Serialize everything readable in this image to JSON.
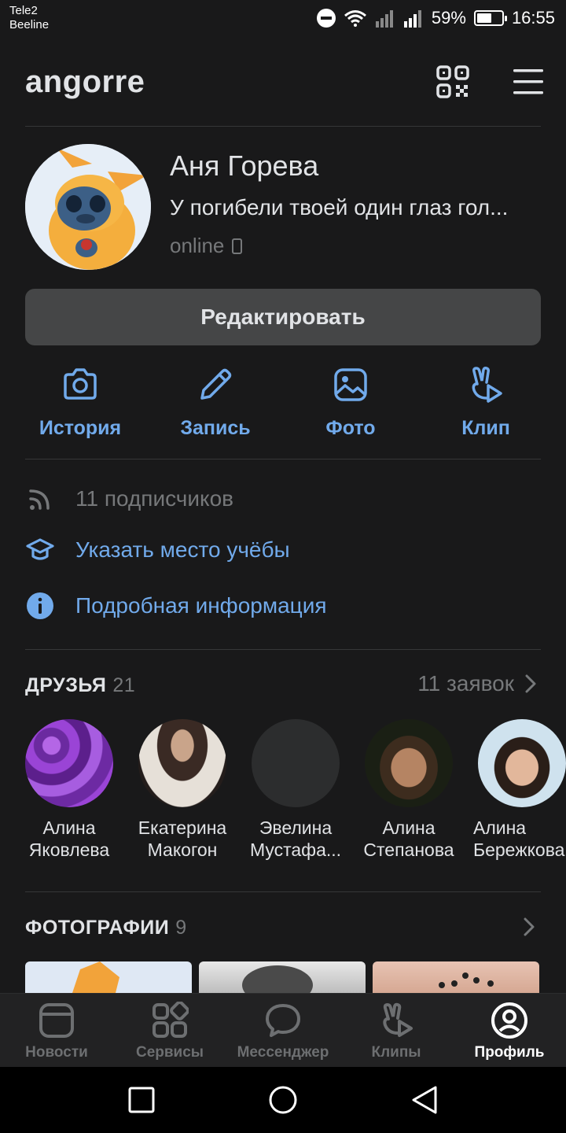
{
  "status_bar": {
    "carrier_1": "Tele2",
    "carrier_2": "Beeline",
    "battery_percent": "59%",
    "battery_level": 0.59,
    "time": "16:55"
  },
  "header": {
    "title": "angorre"
  },
  "profile": {
    "name": "Аня Горева",
    "status": "У погибели твоей один глаз гол...",
    "online": "online",
    "edit_label": "Редактировать"
  },
  "actions": [
    {
      "label": "История",
      "icon": "camera-icon"
    },
    {
      "label": "Запись",
      "icon": "pencil-icon"
    },
    {
      "label": "Фото",
      "icon": "image-icon"
    },
    {
      "label": "Клип",
      "icon": "clip-icon"
    }
  ],
  "info": {
    "followers": "11 подписчиков",
    "education": "Указать место учёбы",
    "details": "Подробная информация"
  },
  "friends": {
    "title": "ДРУЗЬЯ",
    "count": "21",
    "requests": "11 заявок",
    "items": [
      {
        "first": "Алина",
        "last": "Яковлева"
      },
      {
        "first": "Екатерина",
        "last": "Макогон"
      },
      {
        "first": "Эвелина",
        "last": "Мустафа..."
      },
      {
        "first": "Алина",
        "last": "Степанова"
      },
      {
        "first": "Алина",
        "last": "Бережкова"
      }
    ]
  },
  "photos": {
    "title": "ФОТОГРАФИИ",
    "count": "9"
  },
  "tabs": [
    {
      "label": "Новости",
      "icon": "news-icon"
    },
    {
      "label": "Сервисы",
      "icon": "services-icon"
    },
    {
      "label": "Мессенджер",
      "icon": "messenger-icon"
    },
    {
      "label": "Клипы",
      "icon": "clips-icon"
    },
    {
      "label": "Профиль",
      "icon": "profile-icon",
      "active": true
    }
  ],
  "colors": {
    "background": "#19191a",
    "accent": "#71aaeb",
    "secondary_text": "#76787a"
  }
}
